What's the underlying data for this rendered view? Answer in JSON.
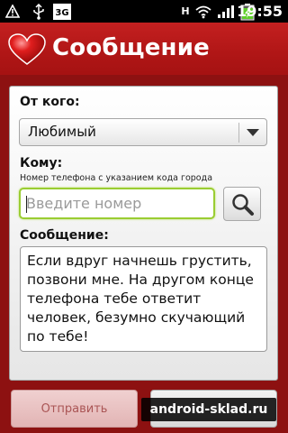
{
  "status_bar": {
    "time": "19:55",
    "network_type": "3G",
    "icons": [
      "warning-icon",
      "usb-icon",
      "sim-icon",
      "wifi-icon",
      "signal-icon",
      "battery-charging-icon"
    ],
    "h_label": "H"
  },
  "header": {
    "title": "Сообщение",
    "icon": "heart-icon",
    "color": "#b51818"
  },
  "form": {
    "from_label": "От кого:",
    "from_value": "Любимый",
    "to_label": "Кому:",
    "to_hint": "Номер телефона с указанием кода города",
    "phone_placeholder": "Введите номер",
    "message_label": "Сообщение:",
    "message_text": "Если вдруг начнешь грустить, позвони мне. На другом конце телефона тебе ответит человек, безумно скучающий по тебе!"
  },
  "buttons": {
    "send_label": "Отправить"
  },
  "watermark": "android-sklad.ru"
}
